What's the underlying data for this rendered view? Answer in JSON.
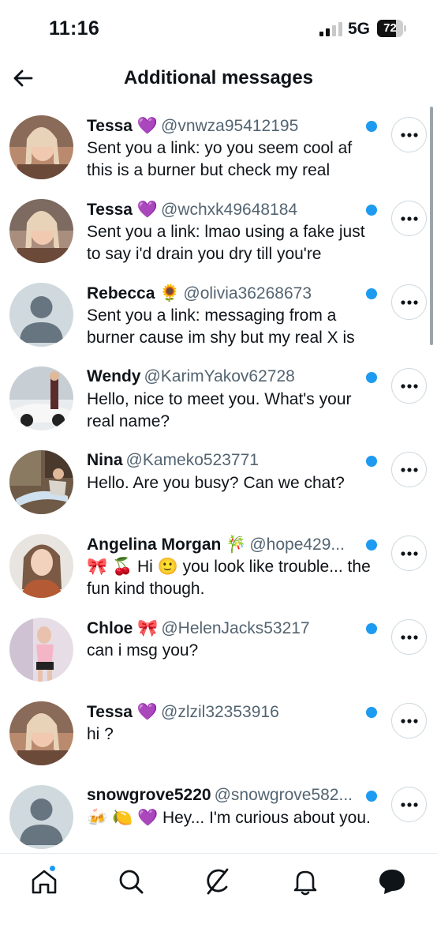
{
  "status_bar": {
    "time": "11:16",
    "network": "5G",
    "battery": "72",
    "battery_level": 0.72
  },
  "header": {
    "title": "Additional messages"
  },
  "messages": [
    {
      "name": "Tessa",
      "emoji": "💜",
      "handle": "@vnwza95412195",
      "preview": "Sent you a link: yo you seem cool af this is a burner but check my real",
      "avatar": "photo"
    },
    {
      "name": "Tessa",
      "emoji": "💜",
      "handle": "@wchxk49648184",
      "preview": "Sent you a link: lmao using a fake just to say i'd drain you dry till you're",
      "avatar": "photo"
    },
    {
      "name": "Rebecca",
      "emoji": "🌻",
      "handle": "@olivia36268673",
      "preview": "Sent you a link: messaging from a burner cause im shy but my real X is",
      "avatar": "default"
    },
    {
      "name": "Wendy",
      "emoji": "",
      "handle": "@KarimYakov62728",
      "preview": "Hello, nice to meet you. What's your real name?",
      "avatar": "photo"
    },
    {
      "name": "Nina",
      "emoji": "",
      "handle": "@Kameko523771",
      "preview": "Hello. Are you busy? Can we chat?",
      "avatar": "photo"
    },
    {
      "name": "Angelina Morgan",
      "emoji": "🎋",
      "handle": "@hope429...",
      "preview": "🎀 🍒 Hi 🙂 you look like trouble... the fun kind though.",
      "avatar": "photo"
    },
    {
      "name": "Chloe",
      "emoji": "🎀",
      "handle": "@HelenJacks53217",
      "preview": "can i msg you?",
      "avatar": "photo"
    },
    {
      "name": "Tessa",
      "emoji": "💜",
      "handle": "@zlzil32353916",
      "preview": "hi ?",
      "avatar": "photo"
    },
    {
      "name": "snowgrove5220",
      "emoji": "",
      "handle": "@snowgrove582...",
      "preview": "🍻 🍋 💜 Hey... I'm curious about you.",
      "avatar": "default"
    }
  ],
  "bottom_nav": [
    {
      "icon": "home-icon",
      "has_badge": true
    },
    {
      "icon": "search-icon"
    },
    {
      "icon": "grok-icon"
    },
    {
      "icon": "bell-icon"
    },
    {
      "icon": "messages-icon"
    }
  ],
  "colors": {
    "accent": "#1d9bf0",
    "secondary_text": "#536471",
    "border": "#cfd9de"
  }
}
